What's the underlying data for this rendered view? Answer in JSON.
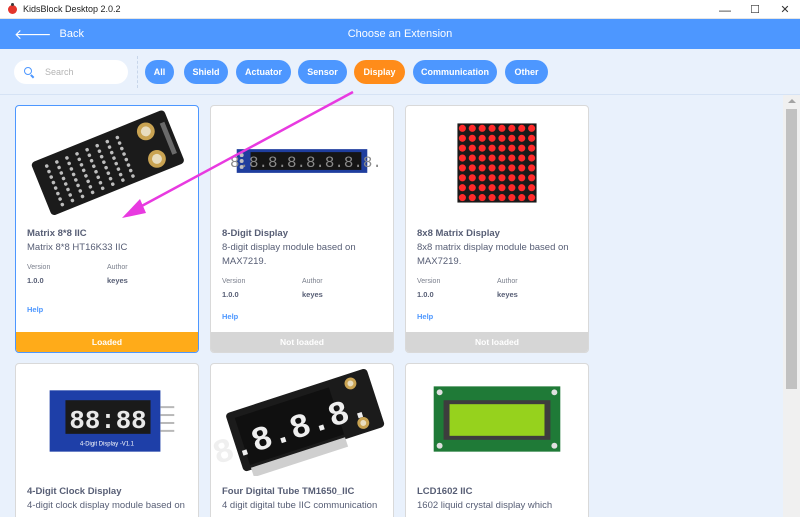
{
  "window": {
    "title": "KidsBlock Desktop 2.0.2",
    "minimize": "—",
    "maximize": "☐",
    "close": "✕"
  },
  "header": {
    "back_icon": "🡐",
    "back_label": "Back",
    "title": "Choose an Extension"
  },
  "search": {
    "placeholder": "Search",
    "value": ""
  },
  "tags": [
    {
      "label": "All",
      "active": false
    },
    {
      "label": "Shield",
      "active": false
    },
    {
      "label": "Actuator",
      "active": false
    },
    {
      "label": "Sensor",
      "active": false
    },
    {
      "label": "Display",
      "active": true
    },
    {
      "label": "Communication",
      "active": false
    },
    {
      "label": "Other",
      "active": false
    }
  ],
  "cards": [
    {
      "title": "Matrix 8*8 IIC",
      "description": "Matrix 8*8 HT16K33 IIC",
      "version_label": "Version",
      "version": "1.0.0",
      "author_label": "Author",
      "author": "keyes",
      "help": "Help",
      "status": "Loaded"
    },
    {
      "title": "8-Digit Display",
      "description": "8-digit display module based on MAX7219.",
      "version_label": "Version",
      "version": "1.0.0",
      "author_label": "Author",
      "author": "keyes",
      "help": "Help",
      "status": "Not loaded"
    },
    {
      "title": "8x8 Matrix Display",
      "description": "8x8 matrix display module based on MAX7219.",
      "version_label": "Version",
      "version": "1.0.0",
      "author_label": "Author",
      "author": "keyes",
      "help": "Help",
      "status": "Not loaded"
    },
    {
      "title": "4-Digit Clock Display",
      "description": "4-digit clock display module based on"
    },
    {
      "title": "Four Digital Tube TM1650_IIC",
      "description": "4 digit digital tube IIC communication"
    },
    {
      "title": "LCD1602 IIC",
      "description": "1602 liquid crystal display which"
    }
  ],
  "images": {
    "digits_8": "8.8.8.8.8.8.8.8.",
    "clock_digits": "88:88",
    "clock_caption": "4-Digit Display -V1.1",
    "tube_digits": "8.8.8.8."
  },
  "colors": {
    "accent": "#4d97ff",
    "active_tag": "#ff8c1a",
    "loaded": "#ffab19",
    "annotation_arrow": "#e83ae0"
  }
}
